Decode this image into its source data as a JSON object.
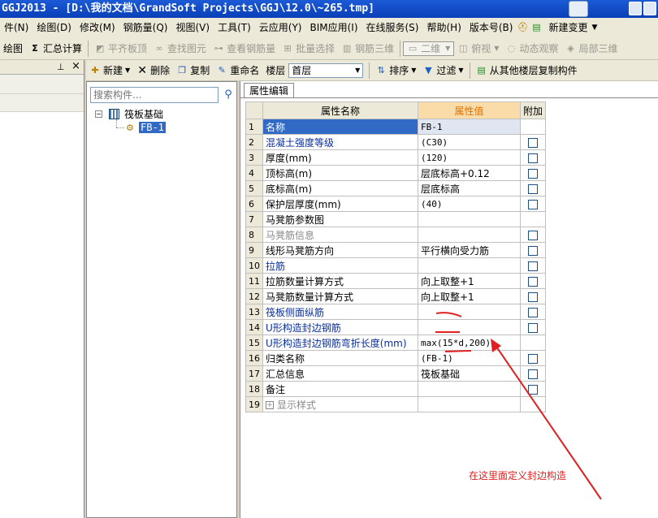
{
  "window": {
    "title": "GGJ2013 - [D:\\我的文档\\GrandSoft Projects\\GGJ\\12.0\\~265.tmp]"
  },
  "menu": [
    "件(N)",
    "绘图(D)",
    "修改(M)",
    "钢筋量(Q)",
    "视图(V)",
    "工具(T)",
    "云应用(Y)",
    "BIM应用(I)",
    "在线服务(S)",
    "帮助(H)",
    "版本号(B)",
    "新建变更"
  ],
  "toolbar1": {
    "draw_label": "绘图",
    "summary_label": "汇总计算",
    "align_label": "平齐板顶",
    "find_label": "查找图元",
    "view_rebar_label": "查看钢筋量",
    "batch_select_label": "批量选择",
    "rebar3d_label": "钢筋三维",
    "view_mode": "二维",
    "top_view_label": "俯视",
    "dynamic_label": "动态观察",
    "local3d_label": "局部三维"
  },
  "comp_toolbar": {
    "new_label": "新建",
    "delete_label": "删除",
    "copy_label": "复制",
    "rename_label": "重命名",
    "floor_label": "楼层",
    "floor_value": "首层",
    "sort_label": "排序",
    "filter_label": "过滤",
    "copy_from_label": "从其他楼层复制构件"
  },
  "tree": {
    "search_placeholder": "搜索构件...",
    "root_label": "筏板基础",
    "child_label": "FB-1"
  },
  "props": {
    "tab_label": "属性编辑",
    "headers": {
      "name": "属性名称",
      "value": "属性值",
      "extra": "附加"
    },
    "rows": [
      {
        "num": "1",
        "name": "名称",
        "value": "FB-1"
      },
      {
        "num": "2",
        "name": "混凝土强度等级",
        "value": "(C30)"
      },
      {
        "num": "3",
        "name": "厚度(mm)",
        "value": "(120)"
      },
      {
        "num": "4",
        "name": "顶标高(m)",
        "value": "层底标高+0.12"
      },
      {
        "num": "5",
        "name": "底标高(m)",
        "value": "层底标高"
      },
      {
        "num": "6",
        "name": "保护层厚度(mm)",
        "value": "(40)"
      },
      {
        "num": "7",
        "name": "马凳筋参数图",
        "value": ""
      },
      {
        "num": "8",
        "name": "马凳筋信息",
        "value": ""
      },
      {
        "num": "9",
        "name": "线形马凳筋方向",
        "value": "平行横向受力筋"
      },
      {
        "num": "10",
        "name": "拉筋",
        "value": ""
      },
      {
        "num": "11",
        "name": "拉筋数量计算方式",
        "value": "向上取整+1"
      },
      {
        "num": "12",
        "name": "马凳筋数量计算方式",
        "value": "向上取整+1"
      },
      {
        "num": "13",
        "name": "筏板侧面纵筋",
        "value": ""
      },
      {
        "num": "14",
        "name": "U形构造封边钢筋",
        "value": ""
      },
      {
        "num": "15",
        "name": "U形构造封边钢筋弯折长度(mm)",
        "value": "max(15*d,200)"
      },
      {
        "num": "16",
        "name": "归类名称",
        "value": "(FB-1)"
      },
      {
        "num": "17",
        "name": "汇总信息",
        "value": "筏板基础"
      },
      {
        "num": "18",
        "name": "备注",
        "value": ""
      },
      {
        "num": "19",
        "name": "显示样式",
        "value": ""
      }
    ]
  },
  "annotation": {
    "text": "在这里面定义封边构造",
    "color": "#e02020"
  }
}
